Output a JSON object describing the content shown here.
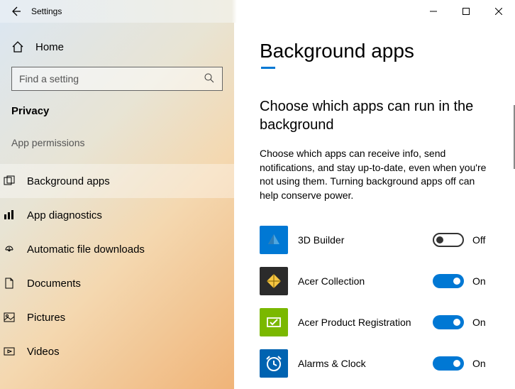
{
  "titlebar": {
    "title": "Settings"
  },
  "sidebar": {
    "home_label": "Home",
    "search_placeholder": "Find a setting",
    "category": "Privacy",
    "section_label": "App permissions",
    "truncated_item": "──────────",
    "items": [
      {
        "label": "Background apps",
        "selected": true
      },
      {
        "label": "App diagnostics",
        "selected": false
      },
      {
        "label": "Automatic file downloads",
        "selected": false
      },
      {
        "label": "Documents",
        "selected": false
      },
      {
        "label": "Pictures",
        "selected": false
      },
      {
        "label": "Videos",
        "selected": false
      }
    ]
  },
  "main": {
    "heading": "Background apps",
    "subheading": "Choose which apps can run in the background",
    "description": "Choose which apps can receive info, send notifications, and stay up-to-date, even when you're not using them. Turning background apps off can help conserve power.",
    "apps": [
      {
        "name": "3D Builder",
        "state": "off",
        "state_label": "Off",
        "icon_bg": "#0078d4",
        "icon_kind": "builder"
      },
      {
        "name": "Acer Collection",
        "state": "on",
        "state_label": "On",
        "icon_bg": "#2b2b2b",
        "icon_kind": "diamond"
      },
      {
        "name": "Acer Product Registration",
        "state": "on",
        "state_label": "On",
        "icon_bg": "#7ab800",
        "icon_kind": "register"
      },
      {
        "name": "Alarms & Clock",
        "state": "on",
        "state_label": "On",
        "icon_bg": "#0063b1",
        "icon_kind": "clock"
      }
    ]
  }
}
